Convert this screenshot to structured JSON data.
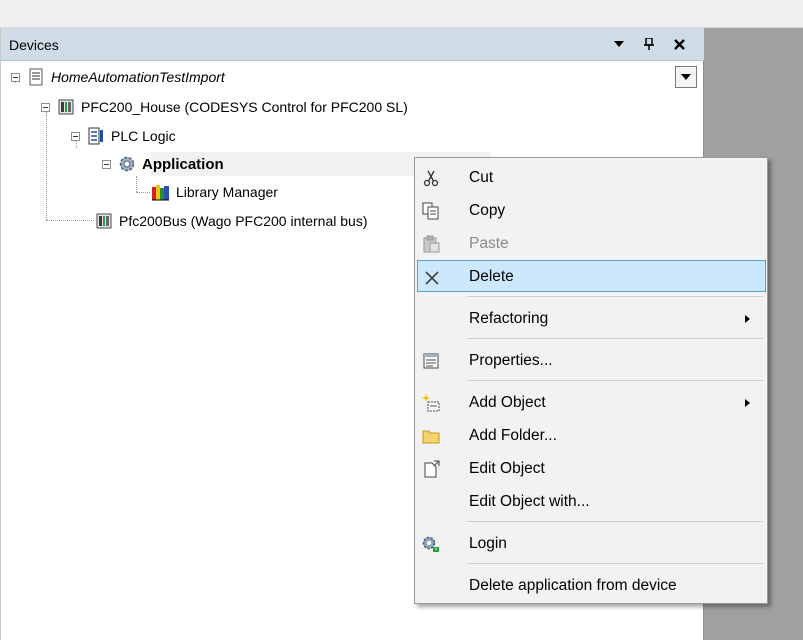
{
  "panel": {
    "title": "Devices"
  },
  "tree": {
    "project": "HomeAutomationTestImport",
    "device": "PFC200_House (CODESYS Control for PFC200 SL)",
    "plc_logic": "PLC Logic",
    "application": "Application",
    "library_manager": "Library Manager",
    "bus": "Pfc200Bus (Wago PFC200 internal bus)"
  },
  "menu": {
    "cut": "Cut",
    "copy": "Copy",
    "paste": "Paste",
    "delete": "Delete",
    "refactoring": "Refactoring",
    "properties": "Properties...",
    "add_object": "Add Object",
    "add_folder": "Add Folder...",
    "edit_object": "Edit Object",
    "edit_object_with": "Edit Object with...",
    "login": "Login",
    "delete_app": "Delete application from device"
  },
  "icons": {
    "dropdown": "chevron-down-icon",
    "pin": "pin-icon",
    "close": "close-icon",
    "cut": "scissors-icon",
    "copy": "copy-icon",
    "paste": "paste-icon",
    "delete": "delete-x-icon",
    "properties": "properties-icon",
    "add_object": "add-object-icon",
    "add_folder": "folder-icon",
    "edit_object": "edit-object-icon",
    "login": "login-gear-icon"
  },
  "colors": {
    "header_bg": "#cfdbe7",
    "highlight_bg": "#cce8ff",
    "highlight_border": "#5aa0dc",
    "menu_bg": "#f2f2f2",
    "gray_area": "#a0a0a0"
  }
}
